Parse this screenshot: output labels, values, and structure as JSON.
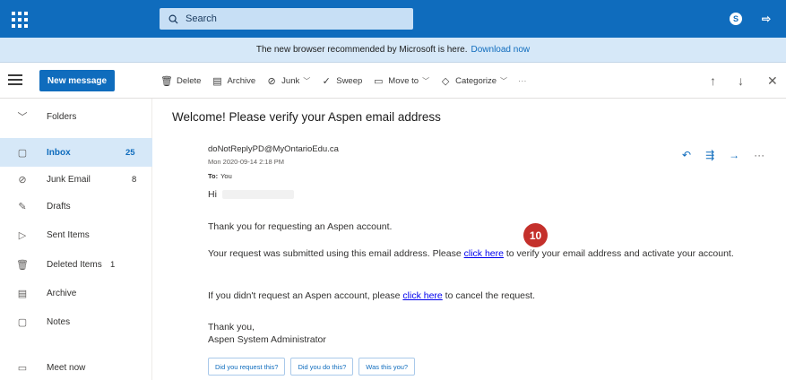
{
  "topbar": {
    "search_placeholder": "Search",
    "skype_icon_label": "S",
    "feedback_icon_label": "⇨"
  },
  "banner": {
    "text": "The new browser recommended by Microsoft is here.",
    "link": "Download now"
  },
  "toolbar": {
    "new_message": "New message",
    "commands": [
      {
        "label": "Delete",
        "icon": "trash-icon"
      },
      {
        "label": "Archive",
        "icon": "archive-icon"
      },
      {
        "label": "Junk",
        "icon": "junk-icon"
      },
      {
        "label": "Sweep",
        "icon": "sweep-icon"
      },
      {
        "label": "Move to",
        "icon": "move-to-icon"
      },
      {
        "label": "Categorize",
        "icon": "tag-icon"
      },
      {
        "label": "···",
        "icon": "more-icon"
      }
    ]
  },
  "sidebar": {
    "folders_label": "Folders",
    "items": [
      {
        "label": "Inbox",
        "count": "25",
        "icon": "inbox-icon"
      },
      {
        "label": "Junk Email",
        "count": "8",
        "icon": "junk-email-icon"
      },
      {
        "label": "Drafts",
        "count": "",
        "icon": "drafts-icon"
      },
      {
        "label": "Sent Items",
        "count": "",
        "icon": "sent-icon"
      },
      {
        "label": "Deleted Items",
        "count": "1",
        "icon": "deleted-icon"
      },
      {
        "label": "Archive",
        "count": "",
        "icon": "archive-folder-icon"
      },
      {
        "label": "Notes",
        "count": "",
        "icon": "notes-icon"
      }
    ],
    "meet_now": "Meet now"
  },
  "message": {
    "subject": "Welcome! Please verify your Aspen email address",
    "sender": "doNotReplyPD@MyOntarioEdu.ca",
    "date": "Mon 2020-09-14 2:18 PM",
    "to_label": "To:",
    "to_value": "You",
    "greeting": "Hi",
    "para1": "Thank you for requesting an Aspen account.",
    "para2_before": "Your request was submitted using this email address. Please ",
    "para2_link": "click here",
    "para2_after": " to verify your email address and activate your account.",
    "para3_before": "If you didn't request an Aspen account, please ",
    "para3_link": "click here",
    "para3_after": " to cancel the request.",
    "signoff": "Thank you,",
    "signature": "Aspen System Administrator",
    "callout_number": "10",
    "suggestions": [
      "Did you request this?",
      "Did you do this?",
      "Was this you?"
    ]
  },
  "colors": {
    "brand": "#0f6cbd",
    "banner_bg": "#d6e8f8",
    "callout": "#c4302b"
  }
}
